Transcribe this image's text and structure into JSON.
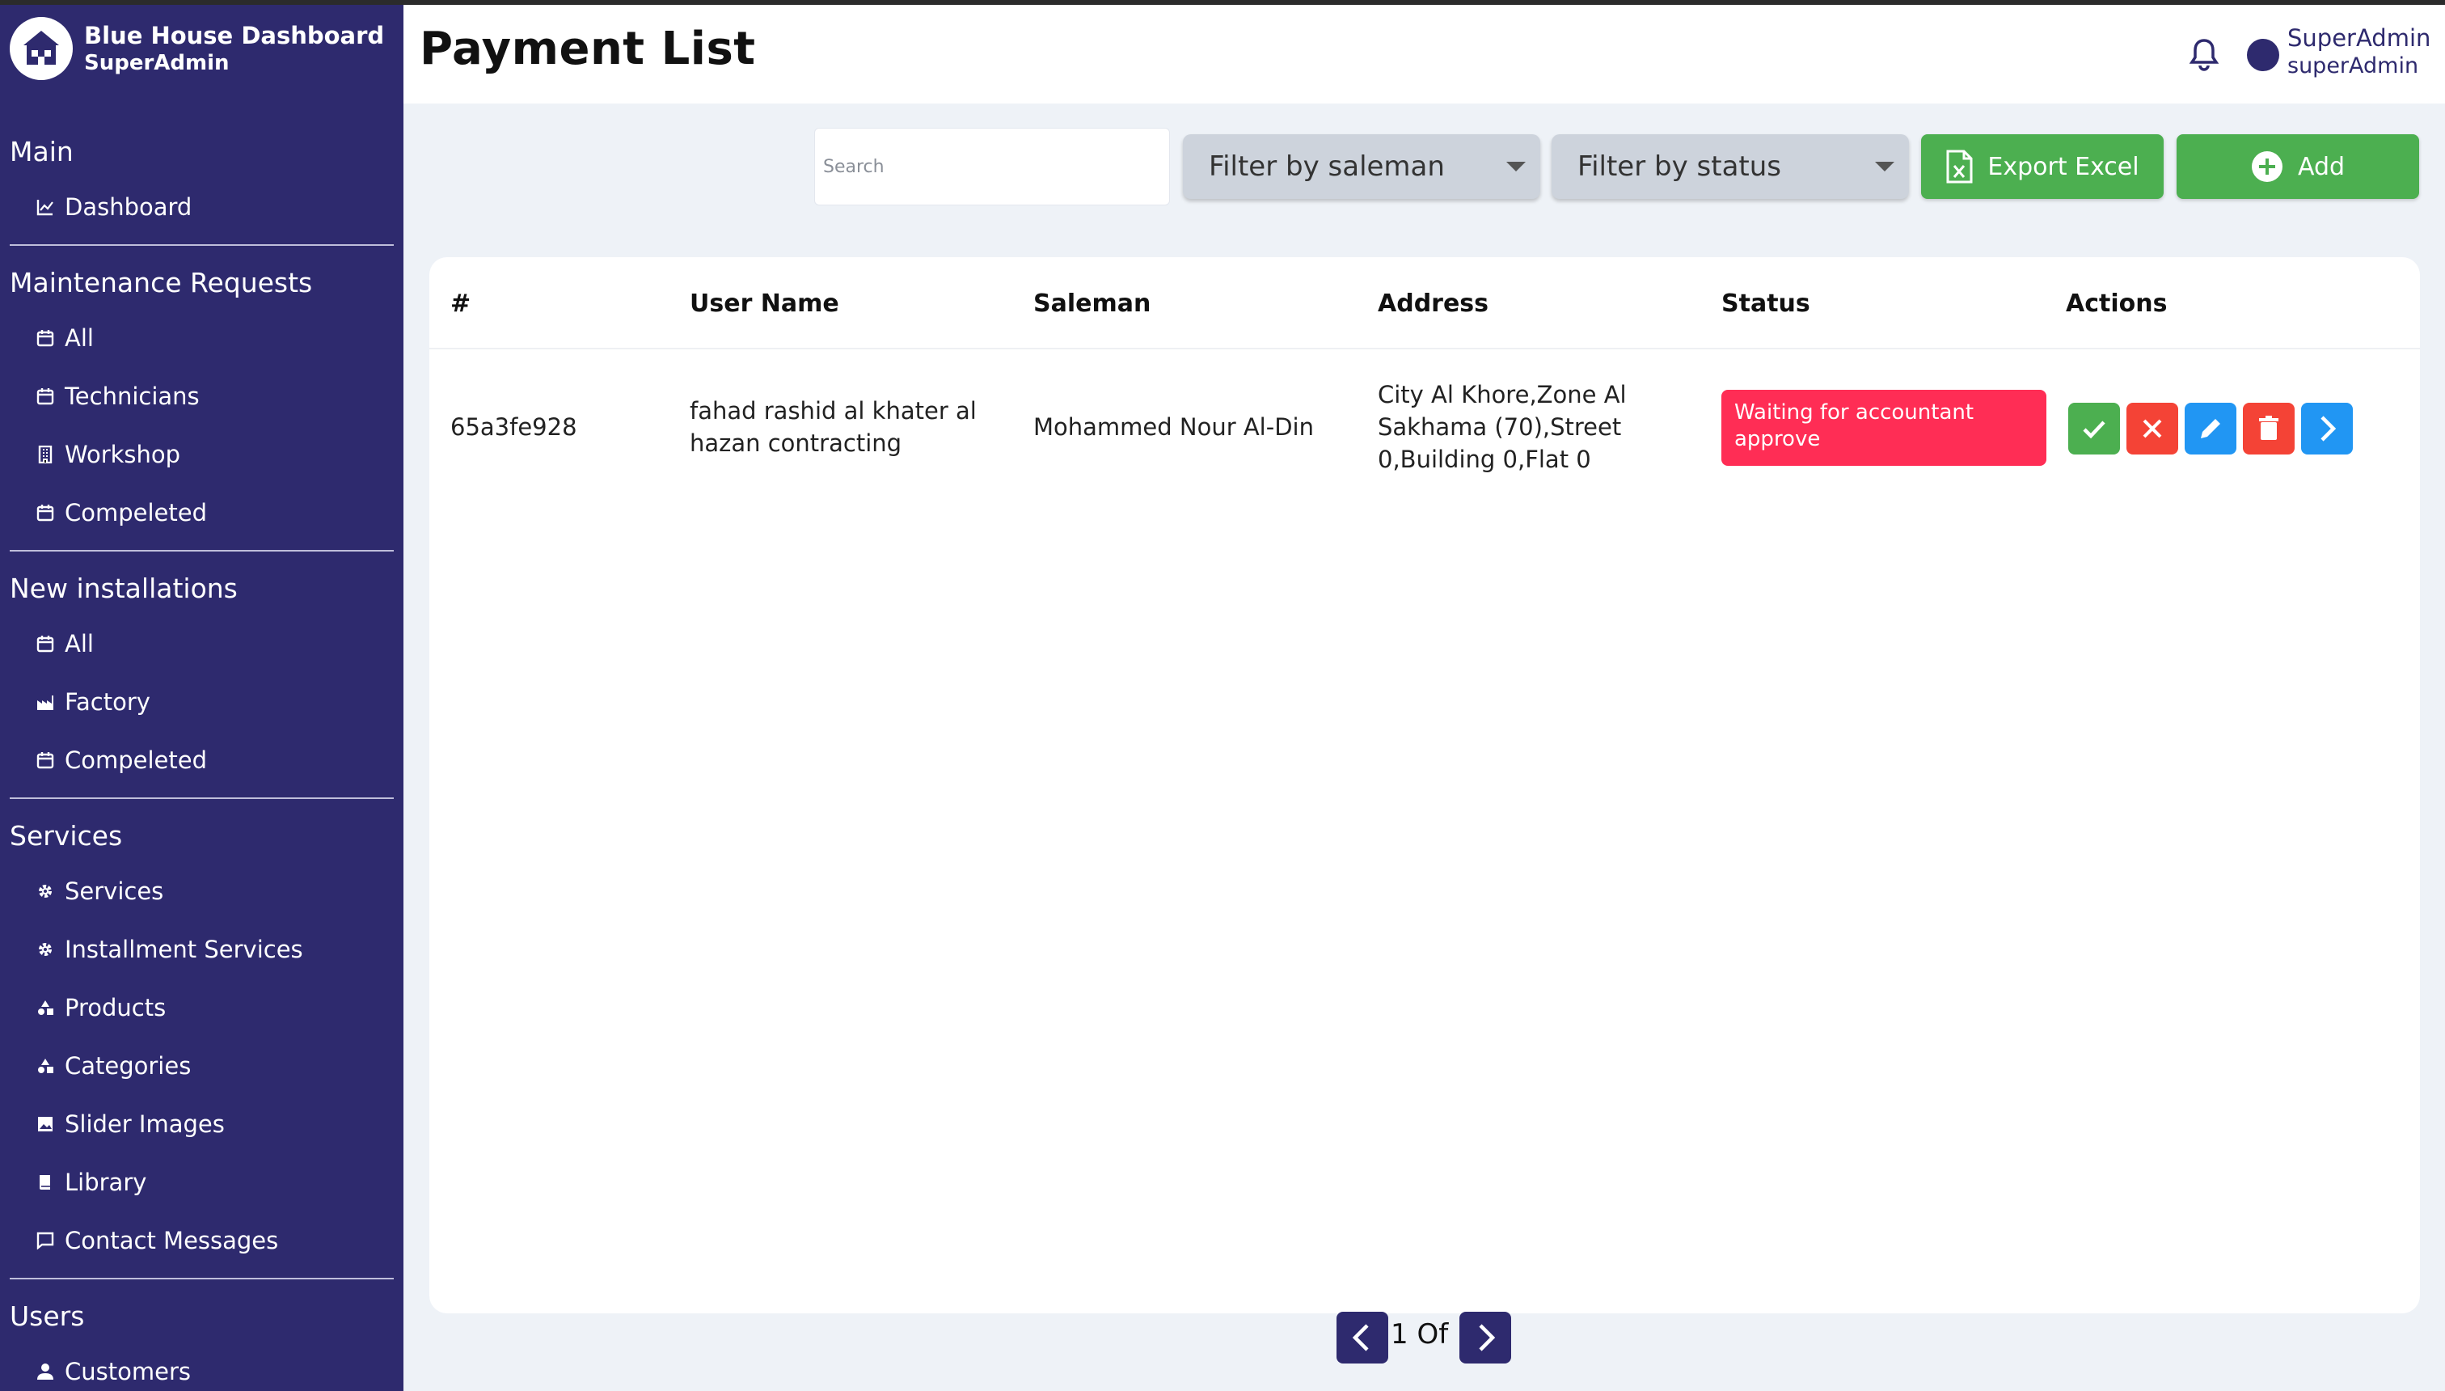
{
  "brand": {
    "title": "Blue House Dashboard",
    "subtitle": "SuperAdmin"
  },
  "sidebar": {
    "sections": [
      {
        "title": "Main",
        "items": [
          {
            "label": "Dashboard",
            "icon": "chart-icon"
          }
        ]
      },
      {
        "title": "Maintenance Requests",
        "items": [
          {
            "label": "All",
            "icon": "calendar-icon"
          },
          {
            "label": "Technicians",
            "icon": "calendar-icon"
          },
          {
            "label": "Workshop",
            "icon": "building-icon"
          },
          {
            "label": "Compeleted",
            "icon": "calendar-icon"
          }
        ]
      },
      {
        "title": "New installations",
        "items": [
          {
            "label": "All",
            "icon": "calendar-icon"
          },
          {
            "label": "Factory",
            "icon": "factory-icon"
          },
          {
            "label": "Compeleted",
            "icon": "calendar-icon"
          }
        ]
      },
      {
        "title": "Services",
        "items": [
          {
            "label": "Services",
            "icon": "gear-icon"
          },
          {
            "label": "Installment Services",
            "icon": "gear-icon"
          },
          {
            "label": "Products",
            "icon": "shapes-icon"
          },
          {
            "label": "Categories",
            "icon": "shapes-icon"
          },
          {
            "label": "Slider Images",
            "icon": "image-icon"
          },
          {
            "label": "Library",
            "icon": "book-icon"
          },
          {
            "label": "Contact Messages",
            "icon": "message-icon"
          }
        ]
      },
      {
        "title": "Users",
        "items": [
          {
            "label": "Customers",
            "icon": "person-icon"
          }
        ]
      }
    ]
  },
  "header": {
    "title": "Payment List",
    "user_name": "SuperAdmin",
    "user_role": "superAdmin"
  },
  "toolbar": {
    "search_placeholder": "Search",
    "filter_saleman": "Filter by saleman",
    "filter_status": "Filter by status",
    "export_label": "Export Excel",
    "add_label": "Add"
  },
  "table": {
    "columns": [
      "#",
      "User Name",
      "Saleman",
      "Address",
      "Status",
      "Actions"
    ],
    "rows": [
      {
        "id": "65a3fe928",
        "user_name": "fahad rashid al khater al hazan contracting",
        "saleman": "Mohammed Nour Al-Din",
        "address": "City Al Khore,Zone Al Sakhama (70),Street 0,Building 0,Flat 0",
        "status": "Waiting for accountant approve"
      }
    ]
  },
  "pagination": {
    "text": "1 Of 1"
  },
  "colors": {
    "sidebar_bg": "#2e2a6e",
    "green": "#4caf50",
    "red": "#f44336",
    "blue": "#2196f3",
    "status_red": "#ff2d55"
  }
}
